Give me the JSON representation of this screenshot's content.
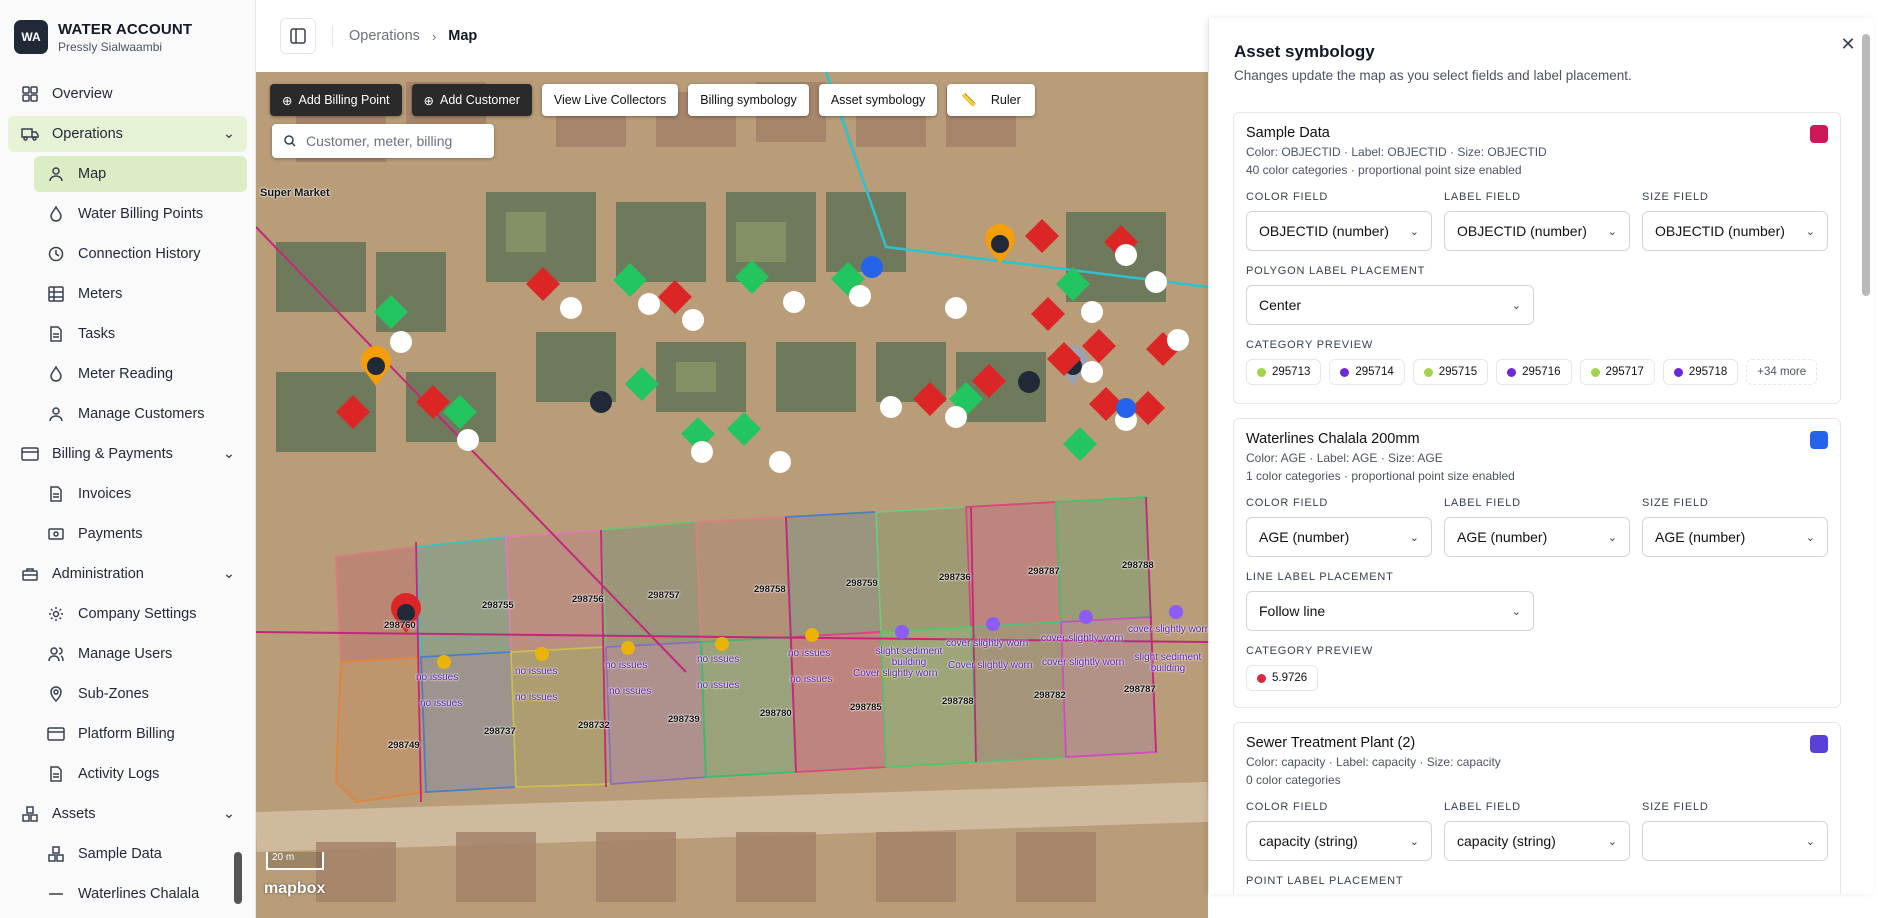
{
  "brand": {
    "logo_text": "WA",
    "title": "WATER ACCOUNT",
    "subtitle": "Pressly Sialwaambi"
  },
  "sidebar": {
    "overview": "Overview",
    "operations": "Operations",
    "operations_items": [
      "Map",
      "Water Billing Points",
      "Connection History",
      "Meters",
      "Tasks",
      "Meter Reading",
      "Manage Customers"
    ],
    "billing": "Billing & Payments",
    "billing_items": [
      "Invoices",
      "Payments"
    ],
    "administration": "Administration",
    "admin_items": [
      "Company Settings",
      "Manage Users",
      "Sub-Zones",
      "Platform Billing",
      "Activity Logs"
    ],
    "assets": "Assets",
    "assets_items": [
      "Sample Data",
      "Waterlines Chalala"
    ]
  },
  "breadcrumb": {
    "parent": "Operations",
    "current": "Map"
  },
  "map": {
    "buttons": {
      "add_billing_point": "Add Billing Point",
      "add_customer": "Add Customer",
      "view_live_collectors": "View Live Collectors",
      "billing_symbology": "Billing symbology",
      "asset_symbology": "Asset symbology",
      "ruler": "Ruler"
    },
    "search_placeholder": "Customer, meter, billing",
    "poi": "Super Market",
    "scale": "20 m",
    "attribution": "mapbox",
    "parcels": [
      "298755",
      "298756",
      "298757",
      "298758",
      "298759",
      "298736",
      "298787",
      "298788",
      "298737",
      "298732",
      "298739",
      "298780",
      "298785",
      "298788",
      "298782",
      "298787",
      "298749",
      "298760"
    ],
    "issues": [
      "no issues",
      "no issues",
      "no issues",
      "no issues",
      "no issues",
      "no issues",
      "no issues",
      "no issues",
      "no issues",
      "no issues",
      "slight sediment building",
      "cover slightly worn",
      "cover slightly worn",
      "Cover slightly worn",
      "Cover slightly worn",
      "cover slightly worn",
      "cover slightly worn",
      "slight sediment building"
    ]
  },
  "panel": {
    "title": "Asset symbology",
    "subtitle": "Changes update the map as you select fields and label placement.",
    "cards": [
      {
        "name": "Sample Data",
        "meta1": "Color: OBJECTID · Label: OBJECTID · Size: OBJECTID",
        "meta2": "40 color categories · proportional point size enabled",
        "swatch": "#d0165a",
        "color_field_label": "COLOR FIELD",
        "label_field_label": "LABEL FIELD",
        "size_field_label": "SIZE FIELD",
        "color_field": "OBJECTID (number)",
        "label_field": "OBJECTID (number)",
        "size_field": "OBJECTID (number)",
        "placement_label": "POLYGON LABEL PLACEMENT",
        "placement": "Center",
        "category_label": "CATEGORY PREVIEW",
        "chips": [
          {
            "text": "295713",
            "color": "#a3d34a"
          },
          {
            "text": "295714",
            "color": "#6d28d9"
          },
          {
            "text": "295715",
            "color": "#a3d34a"
          },
          {
            "text": "295716",
            "color": "#6d28d9"
          },
          {
            "text": "295717",
            "color": "#a3d34a"
          },
          {
            "text": "295718",
            "color": "#6d28d9"
          }
        ],
        "more": "+34 more"
      },
      {
        "name": "Waterlines Chalala 200mm",
        "meta1": "Color: AGE · Label: AGE · Size: AGE",
        "meta2": "1 color categories · proportional point size enabled",
        "swatch": "#2563eb",
        "color_field_label": "COLOR FIELD",
        "label_field_label": "LABEL FIELD",
        "size_field_label": "SIZE FIELD",
        "color_field": "AGE (number)",
        "label_field": "AGE (number)",
        "size_field": "AGE (number)",
        "placement_label": "LINE LABEL PLACEMENT",
        "placement": "Follow line",
        "category_label": "CATEGORY PREVIEW",
        "chips": [
          {
            "text": "5.9726",
            "color": "#dc2642"
          }
        ]
      },
      {
        "name": "Sewer Treatment Plant (2)",
        "meta1": "Color: capacity · Label: capacity · Size: capacity",
        "meta2": "0 color categories",
        "swatch": "#5b3fd6",
        "color_field_label": "COLOR FIELD",
        "label_field_label": "LABEL FIELD",
        "size_field_label": "SIZE FIELD",
        "color_field": "capacity (string)",
        "label_field": "capacity (string)",
        "size_field": "",
        "placement_label": "POINT LABEL PLACEMENT"
      }
    ]
  }
}
